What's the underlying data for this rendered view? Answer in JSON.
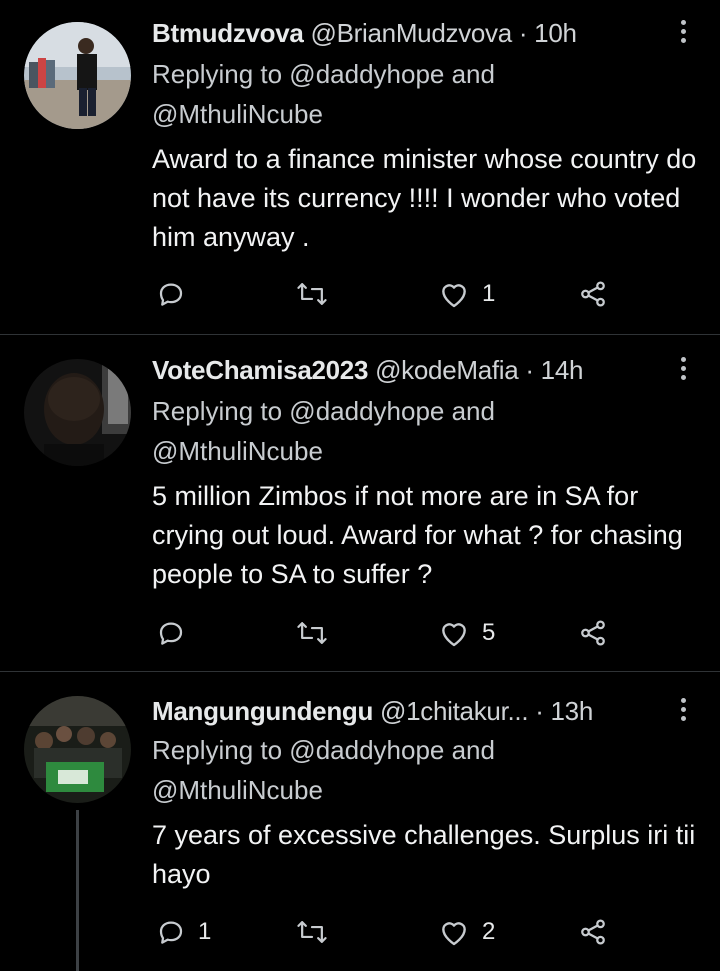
{
  "tweets": [
    {
      "name": "Btmudzvova",
      "handle": "@BrianMudzvova",
      "dot": "·",
      "time": "10h",
      "replying_line1": "Replying to @daddyhope and",
      "replying_line2": "@MthuliNcube",
      "text": "Award to a finance minister whose country do not have its currency !!!! I wonder who voted him anyway .",
      "reply_count": "",
      "retweet_count": "",
      "like_count": "1"
    },
    {
      "name": "VoteChamisa2023",
      "handle": "@kodeMafia",
      "dot": "·",
      "time": "14h",
      "replying_line1": "Replying to @daddyhope and",
      "replying_line2": "@MthuliNcube",
      "text": "5 million Zimbos if not more are in SA for crying out loud. Award for what ? for chasing people to SA to suffer ?",
      "reply_count": "",
      "retweet_count": "",
      "like_count": "5"
    },
    {
      "name": "Mangungundengu",
      "handle": "@1chitakur...",
      "dot": "·",
      "time": "13h",
      "replying_line1": "Replying to @daddyhope and",
      "replying_line2": "@MthuliNcube",
      "text": "7 years of excessive challenges. Surplus iri tii hayo",
      "reply_count": "1",
      "retweet_count": "",
      "like_count": "2"
    }
  ],
  "icons": {
    "reply": "reply-icon",
    "retweet": "retweet-icon",
    "like": "heart-icon",
    "share": "share-icon",
    "more": "more-options-icon"
  },
  "colors": {
    "background": "#000000",
    "text": "#e7e9ea",
    "secondary": "#c8ccd0",
    "divider": "#2f3336"
  }
}
